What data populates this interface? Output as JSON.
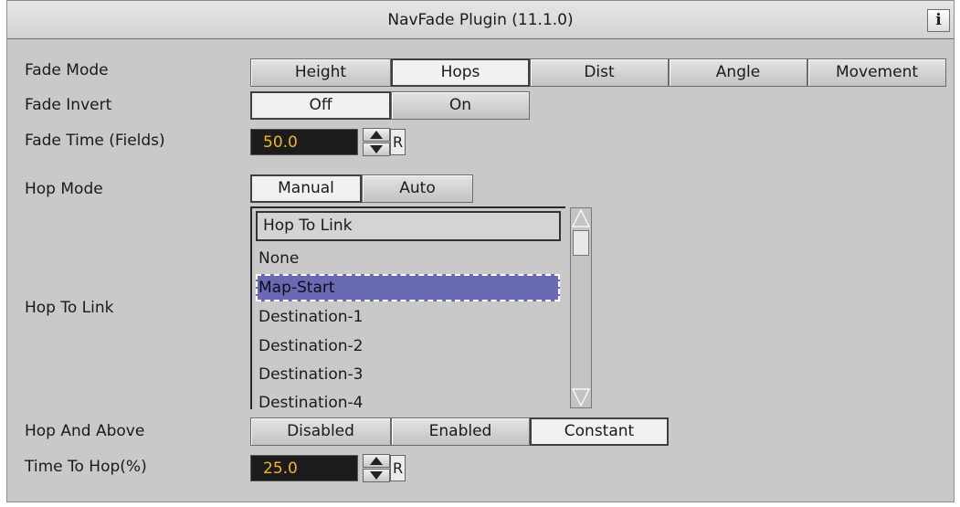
{
  "title": "NavFade Plugin (11.1.0)",
  "info_label": "i",
  "fade_mode": {
    "label": "Fade Mode",
    "options": [
      "Height",
      "Hops",
      "Dist",
      "Angle",
      "Movement"
    ],
    "selected": "Hops"
  },
  "fade_invert": {
    "label": "Fade Invert",
    "options": [
      "Off",
      "On"
    ],
    "selected": "Off"
  },
  "fade_time": {
    "label": "Fade Time (Fields)",
    "value": "50.0",
    "reset_label": "R"
  },
  "hop_mode": {
    "label": "Hop Mode",
    "options": [
      "Manual",
      "Auto"
    ],
    "selected": "Manual"
  },
  "hop_to_link": {
    "label": "Hop To Link",
    "list_header": "Hop To Link",
    "items": [
      "None",
      "Map-Start",
      "Destination-1",
      "Destination-2",
      "Destination-3",
      "Destination-4"
    ],
    "selected": "Map-Start"
  },
  "hop_and_above": {
    "label": "Hop And Above",
    "options": [
      "Disabled",
      "Enabled",
      "Constant"
    ],
    "selected": "Constant"
  },
  "time_to_hop": {
    "label": "Time To Hop(%)",
    "value": "25.0",
    "reset_label": "R"
  },
  "colors": {
    "panel_bg": "#c9c9c9",
    "field_bg": "#1c1c1c",
    "field_text": "#f0b429",
    "selection_bg": "#6a6ab2"
  }
}
